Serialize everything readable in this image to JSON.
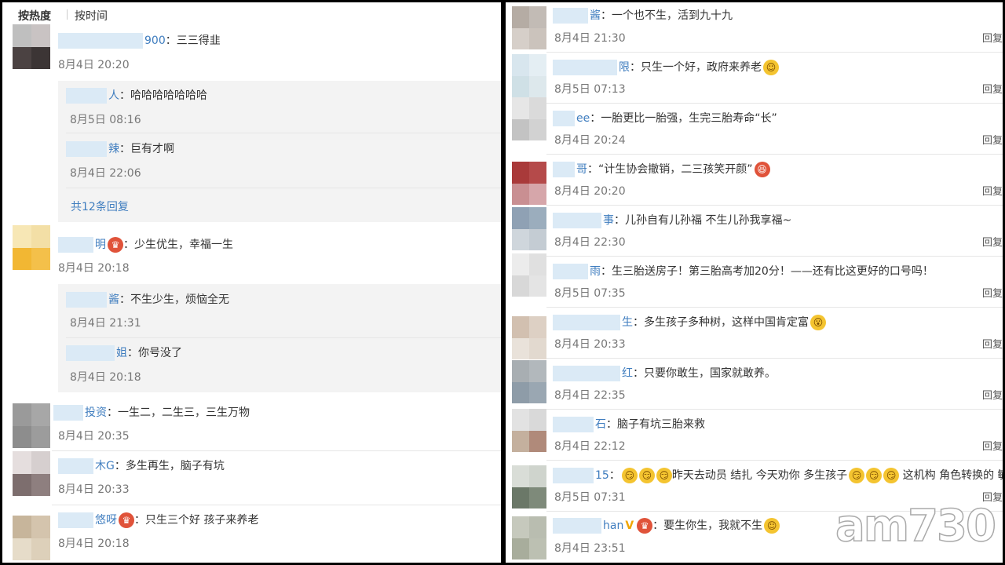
{
  "tabs": {
    "hot": "按热度",
    "time": "按时间"
  },
  "left_comments": [
    {
      "name": "900",
      "text": "三三得韭",
      "time": "8月4日 20:20"
    },
    {
      "name": "明",
      "text": "少生优生，幸福一生",
      "time": "8月4日 20:18"
    },
    {
      "name": "投资",
      "text": "一生二，二生三，三生万物",
      "time": "8月4日 20:35"
    },
    {
      "name": "木G",
      "text": "多生再生，脑子有坑",
      "time": "8月4日 20:33"
    },
    {
      "name": "悠呀",
      "text": "只生三个好 孩子来养老",
      "time": "8月4日 20:18"
    }
  ],
  "left_replies_1": [
    {
      "name": "人",
      "text": "哈哈哈哈哈哈哈",
      "time": "8月5日 08:16"
    },
    {
      "name": "辣",
      "text": "巨有才啊",
      "time": "8月4日 22:06"
    }
  ],
  "left_more": "共12条回复",
  "left_replies_2": [
    {
      "name": "酱",
      "text": "不生少生，烦恼全无",
      "time": "8月4日 21:31"
    },
    {
      "name": "姐",
      "text": "你号没了",
      "time": "8月4日 20:18"
    }
  ],
  "right_comments": [
    {
      "name": "酱",
      "text": "一个也不生，活到九十九",
      "time": "8月4日 21:30"
    },
    {
      "name": "限",
      "text": "只生一个好，政府来养老",
      "time": "8月5日 07:13"
    },
    {
      "name": "ee",
      "text": "一胎更比一胎强，生完三胎寿命“长”",
      "time": "8月4日 20:24"
    },
    {
      "name": "哥",
      "text": "“计生协会撤销，二三孩笑开颜”",
      "time": "8月4日 20:20"
    },
    {
      "name": "事",
      "text": "儿孙自有儿孙福 不生儿孙我享福~",
      "time": "8月4日 22:30"
    },
    {
      "name": "雨",
      "text": "生三胎送房子！第三胎高考加20分！——还有比这更好的口号吗！",
      "time": "8月5日 07:35"
    },
    {
      "name": "生",
      "text": "多生孩子多种树，这样中国肯定富",
      "time": "8月4日 20:33"
    },
    {
      "name": "红",
      "text": "只要你敢生，国家就敢养。",
      "time": "8月4日 22:35"
    },
    {
      "name": "石",
      "text": "脑子有坑三胎来救",
      "time": "8月4日 22:12"
    },
    {
      "name": "15",
      "text": "昨天去动员 结扎 今天劝你 多生孩子",
      "text2": "这机构 角色转换的 敏",
      "time": "8月5日 07:31"
    },
    {
      "name": "han",
      "text": "要生你生，我就不生",
      "time": "8月4日 23:51"
    }
  ],
  "reply_label": "回复",
  "watermark": "am730",
  "colors": {
    "link": "#3f7dbf",
    "reply_bg": "#f3f3f3",
    "blur": "#dbeaf6"
  }
}
